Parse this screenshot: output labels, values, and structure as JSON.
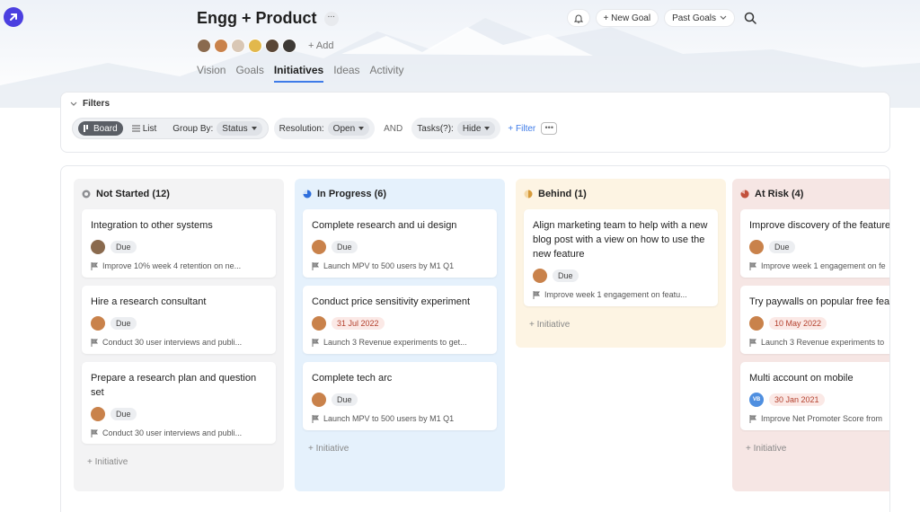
{
  "header": {
    "title": "Engg + Product",
    "more": "···",
    "add_member": "+ Add",
    "tabs": [
      "Vision",
      "Goals",
      "Initiatives",
      "Ideas",
      "Activity"
    ],
    "active_tab": "Initiatives"
  },
  "topbar": {
    "new_goal": "+ New Goal",
    "past_goals": "Past Goals"
  },
  "filters": {
    "heading": "Filters",
    "view_board": "Board",
    "view_list": "List",
    "group_by_label": "Group By:",
    "group_by_value": "Status",
    "resolution_label": "Resolution:",
    "resolution_value": "Open",
    "and_label": "AND",
    "tasks_label": "Tasks(?):",
    "tasks_value": "Hide",
    "add_filter": "+ Filter",
    "more": "•••"
  },
  "colors": {
    "accent": "#3e7be8",
    "not_started_bg": "#f3f3f4",
    "in_progress_bg": "#e5f1fc",
    "behind_bg": "#fdf4e3",
    "at_risk_bg": "#f6e6e4"
  },
  "board": {
    "add_initiative": "+ Initiative",
    "columns": [
      {
        "title": "Not Started (12)",
        "cards": [
          {
            "title": "Integration to other systems",
            "due": "Due",
            "goal": "Improve 10% week 4 retention on ne..."
          },
          {
            "title": "Hire a research consultant",
            "due": "Due",
            "goal": "Conduct 30 user interviews and publi..."
          },
          {
            "title": "Prepare a research plan and question set",
            "due": "Due",
            "goal": "Conduct 30 user interviews and publi..."
          }
        ]
      },
      {
        "title": "In Progress (6)",
        "cards": [
          {
            "title": "Complete research and ui design",
            "due": "Due",
            "goal": "Launch MPV to 500 users by M1 Q1"
          },
          {
            "title": "Conduct price sensitivity experiment",
            "due": "31 Jul 2022",
            "goal": "Launch 3 Revenue experiments to get..."
          },
          {
            "title": "Complete tech arc",
            "due": "Due",
            "goal": "Launch MPV to 500 users by M1 Q1"
          }
        ]
      },
      {
        "title": "Behind (1)",
        "cards": [
          {
            "title": "Align marketing team to help with a new blog post with a view on how to use the new feature",
            "due": "Due",
            "goal": "Improve week 1 engagement on featu..."
          }
        ]
      },
      {
        "title": "At Risk (4)",
        "cards": [
          {
            "title": "Improve discovery of the feature",
            "due": "Due",
            "goal": "Improve week 1 engagement on fe"
          },
          {
            "title": "Try paywalls on popular free feat",
            "due": "10 May 2022",
            "goal": "Launch 3 Revenue experiments to"
          },
          {
            "title": "Multi account on mobile",
            "due": "30 Jan 2021",
            "goal": "Improve Net Promoter Score from",
            "avatar_initials": "VB"
          }
        ]
      }
    ]
  }
}
